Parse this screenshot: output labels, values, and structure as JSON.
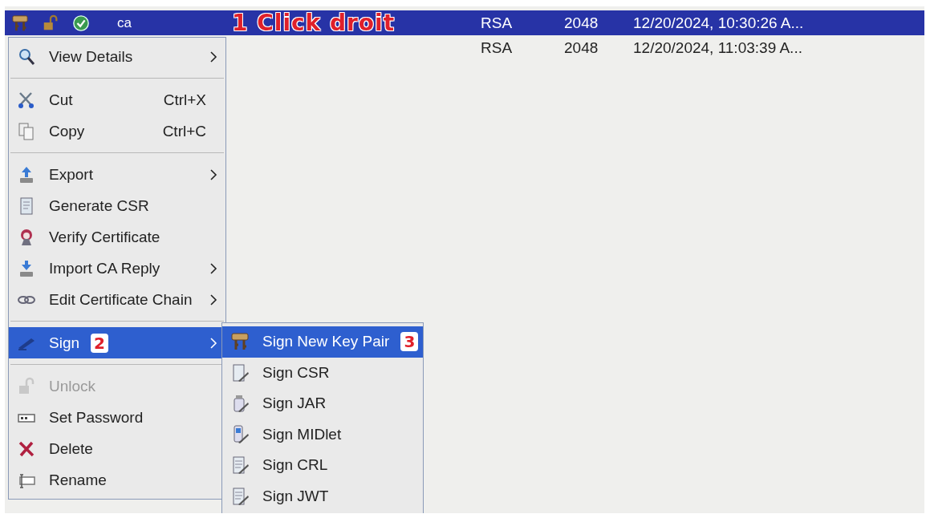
{
  "table": {
    "rows": [
      {
        "selected": true,
        "alias": "ca",
        "annotation": "1 Click droit",
        "algorithm": "RSA",
        "key_size": "2048",
        "date": "12/20/2024, 10:30:26 A..."
      },
      {
        "selected": false,
        "algorithm": "RSA",
        "key_size": "2048",
        "date": "12/20/2024, 11:03:39 A..."
      }
    ]
  },
  "context_menu": {
    "sections": [
      [
        {
          "label": "View Details",
          "submenu": true,
          "selected": false,
          "disabled": false
        }
      ],
      [
        {
          "label": "Cut",
          "shortcut": "Ctrl+X",
          "submenu": false,
          "selected": false,
          "disabled": false
        },
        {
          "label": "Copy",
          "shortcut": "Ctrl+C",
          "submenu": false,
          "selected": false,
          "disabled": false
        }
      ],
      [
        {
          "label": "Export",
          "submenu": true,
          "selected": false,
          "disabled": false
        },
        {
          "label": "Generate CSR",
          "submenu": false,
          "selected": false,
          "disabled": false
        },
        {
          "label": "Verify Certificate",
          "submenu": false,
          "selected": false,
          "disabled": false
        },
        {
          "label": "Import CA Reply",
          "submenu": true,
          "selected": false,
          "disabled": false
        },
        {
          "label": "Edit Certificate Chain",
          "submenu": true,
          "selected": false,
          "disabled": false
        }
      ],
      [
        {
          "label": "Sign",
          "annotation": "2",
          "submenu": true,
          "selected": true,
          "disabled": false
        }
      ],
      [
        {
          "label": "Unlock",
          "submenu": false,
          "selected": false,
          "disabled": true
        },
        {
          "label": "Set Password",
          "submenu": false,
          "selected": false,
          "disabled": false
        },
        {
          "label": "Delete",
          "submenu": false,
          "selected": false,
          "disabled": false
        },
        {
          "label": "Rename",
          "submenu": false,
          "selected": false,
          "disabled": false
        }
      ]
    ]
  },
  "sign_submenu": {
    "items": [
      {
        "label": "Sign New Key Pair",
        "annotation": "3",
        "selected": true
      },
      {
        "label": "Sign CSR",
        "selected": false
      },
      {
        "label": "Sign JAR",
        "selected": false
      },
      {
        "label": "Sign MIDlet",
        "selected": false
      },
      {
        "label": "Sign CRL",
        "selected": false
      },
      {
        "label": "Sign JWT",
        "selected": false
      }
    ]
  }
}
